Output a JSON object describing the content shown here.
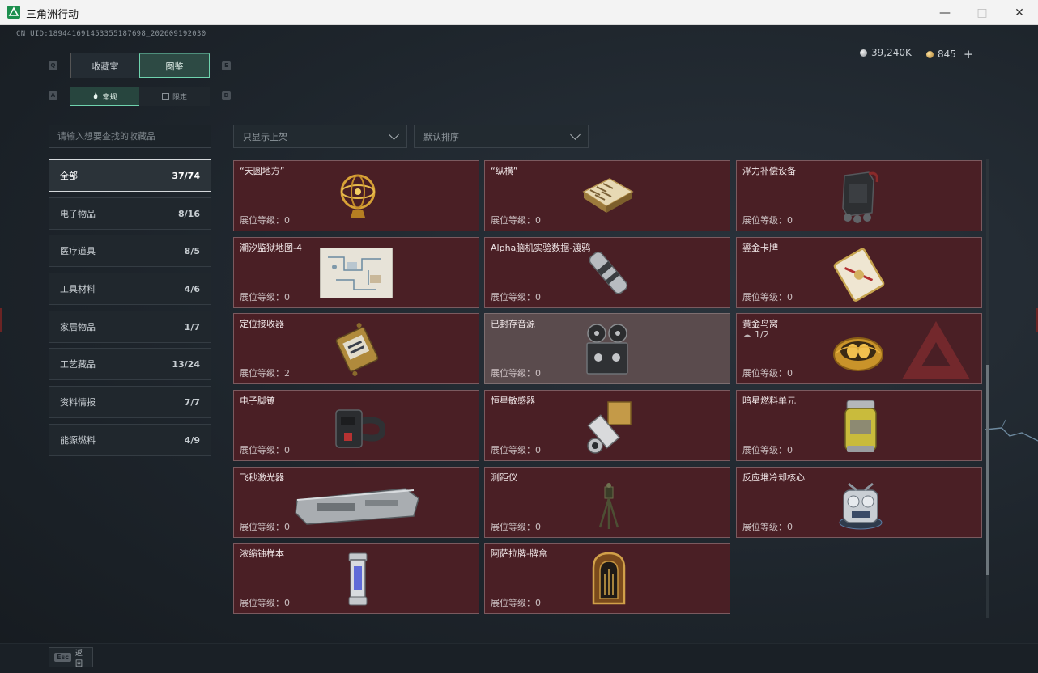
{
  "window": {
    "title": "三角洲行动"
  },
  "header": {
    "cnuid": "CN UID:189441691453355187698_202609192030",
    "currency_silver": "39,240K",
    "currency_gold": "845",
    "plus": "+"
  },
  "tabs": [
    {
      "label": "收藏室"
    },
    {
      "label": "图鉴"
    }
  ],
  "subtabs": [
    {
      "label": "常规"
    },
    {
      "label": "限定"
    }
  ],
  "search": {
    "placeholder": "请输入想要查找的收藏品"
  },
  "filters": {
    "shelf": "只显示上架",
    "sort": "默认排序"
  },
  "categories": [
    {
      "label": "全部",
      "count": "37/74"
    },
    {
      "label": "电子物品",
      "count": "8/16"
    },
    {
      "label": "医疗道具",
      "count": "8/5"
    },
    {
      "label": "工具材料",
      "count": "4/6"
    },
    {
      "label": "家居物品",
      "count": "1/7"
    },
    {
      "label": "工艺藏品",
      "count": "13/24"
    },
    {
      "label": "资料情报",
      "count": "7/7"
    },
    {
      "label": "能源燃料",
      "count": "4/9"
    }
  ],
  "items": [
    {
      "name": "“天圆地方”",
      "level": "展位等级：0",
      "icon": "armillary-sphere-icon"
    },
    {
      "name": "“纵横”",
      "level": "展位等级：0",
      "icon": "chessboard-icon"
    },
    {
      "name": "浮力补偿设备",
      "level": "展位等级：0",
      "icon": "buoyancy-device-icon"
    },
    {
      "name": "潮汐监狱地图-4",
      "level": "展位等级：0",
      "icon": "map-icon"
    },
    {
      "name": "Alpha脑机实验数据-渡鸦",
      "level": "展位等级：0",
      "icon": "data-canister-icon"
    },
    {
      "name": "鎏金卡牌",
      "level": "展位等级：0",
      "icon": "gold-card-icon"
    },
    {
      "name": "定位接收器",
      "level": "展位等级：2",
      "icon": "receiver-icon"
    },
    {
      "name": "已封存音源",
      "level": "展位等级：0",
      "icon": "reel-recorder-icon"
    },
    {
      "name": "黄金鸟窝",
      "sub": "1/2",
      "level": "展位等级：0",
      "icon": "golden-nest-icon"
    },
    {
      "name": "电子脚镣",
      "level": "展位等级：0",
      "icon": "ankle-monitor-icon"
    },
    {
      "name": "恒星敏感器",
      "level": "展位等级：0",
      "icon": "star-sensor-icon"
    },
    {
      "name": "暗星燃料单元",
      "level": "展位等级：0",
      "icon": "fuel-cell-icon"
    },
    {
      "name": "飞秒激光器",
      "level": "展位等级：0",
      "icon": "laser-box-icon"
    },
    {
      "name": "测距仪",
      "level": "展位等级：0",
      "icon": "rangefinder-icon"
    },
    {
      "name": "反应堆冷却核心",
      "level": "展位等级：0",
      "icon": "reactor-core-icon"
    },
    {
      "name": "浓缩铀样本",
      "level": "展位等级：0",
      "icon": "uranium-sample-icon"
    },
    {
      "name": "阿萨拉牌-牌盒",
      "level": "展位等级：0",
      "icon": "card-box-icon"
    }
  ],
  "footer": {
    "esc_key": "Esc",
    "esc_label": "返回"
  },
  "colors": {
    "accent": "#6fd3ae",
    "card_bg": "#4a1f25",
    "card_dim_bg": "#5a4b4d"
  }
}
